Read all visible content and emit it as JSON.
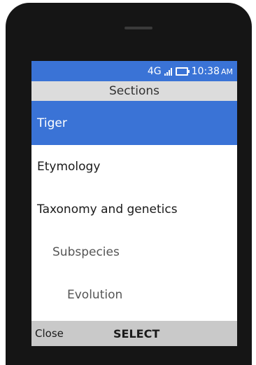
{
  "status_bar": {
    "network": "4G",
    "time": "10:38",
    "ampm": "AM",
    "icons": [
      "signal-icon",
      "battery-icon"
    ]
  },
  "header": {
    "title": "Sections"
  },
  "sections": [
    {
      "label": "Tiger",
      "level": 0,
      "selected": true
    },
    {
      "label": "Etymology",
      "level": 0,
      "selected": false
    },
    {
      "label": "Taxonomy and genetics",
      "level": 0,
      "selected": false
    },
    {
      "label": "Subspecies",
      "level": 1,
      "selected": false
    },
    {
      "label": "Evolution",
      "level": 2,
      "selected": false
    }
  ],
  "softkeys": {
    "left": "Close",
    "center": "SELECT"
  },
  "colors": {
    "accent": "#3a73d6",
    "header_bg": "#dcdcdc",
    "softkey_bg": "#c9c9c9",
    "device_body": "#151515"
  }
}
